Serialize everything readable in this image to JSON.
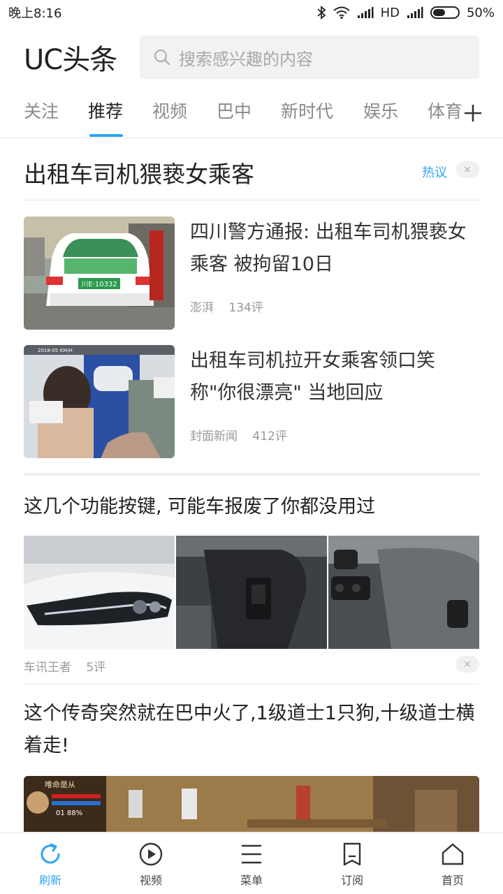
{
  "status_bar": {
    "time": "晚上8:16",
    "network": "HD",
    "battery": "50%",
    "battery_level": 0.5
  },
  "header": {
    "logo": "UC头条",
    "search_placeholder": "搜索感兴趣的内容"
  },
  "tabs": [
    {
      "label": "关注"
    },
    {
      "label": "推荐"
    },
    {
      "label": "视频"
    },
    {
      "label": "巴中"
    },
    {
      "label": "新时代"
    },
    {
      "label": "娱乐"
    },
    {
      "label": "体育"
    }
  ],
  "active_tab": "推荐",
  "hot_topic": {
    "title": "出租车司机猥亵女乘客",
    "tag": "热议",
    "close": "×",
    "items": [
      {
        "title": "四川警方通报: 出租车司机猥亵女乘客 被拘留10日",
        "source": "澎湃",
        "comments": "134评",
        "plate": "川E·10332"
      },
      {
        "title": "出租车司机拉开女乘客领口笑称\"你很漂亮\" 当地回应",
        "source": "封面新闻",
        "comments": "412评",
        "overlay_text": "2018-05 KM/H"
      }
    ]
  },
  "article": {
    "title": "这几个功能按键, 可能车报废了你都没用过",
    "source": "车讯王者",
    "comments": "5评",
    "close": "×"
  },
  "article2": {
    "title": "这个传奇突然就在巴中火了,1级道士1只狗,十级道士横着走!",
    "game_hud": "01 88%",
    "game_name": "唯命是从"
  },
  "bottom_nav": [
    {
      "label": "刷新",
      "icon": "refresh-icon"
    },
    {
      "label": "视频",
      "icon": "play-icon"
    },
    {
      "label": "菜单",
      "icon": "menu-icon"
    },
    {
      "label": "订阅",
      "icon": "bookmark-icon"
    },
    {
      "label": "首页",
      "icon": "home-icon"
    }
  ],
  "colors": {
    "accent": "#2ea3f2",
    "text": "#222222",
    "secondary_text": "#999999"
  }
}
